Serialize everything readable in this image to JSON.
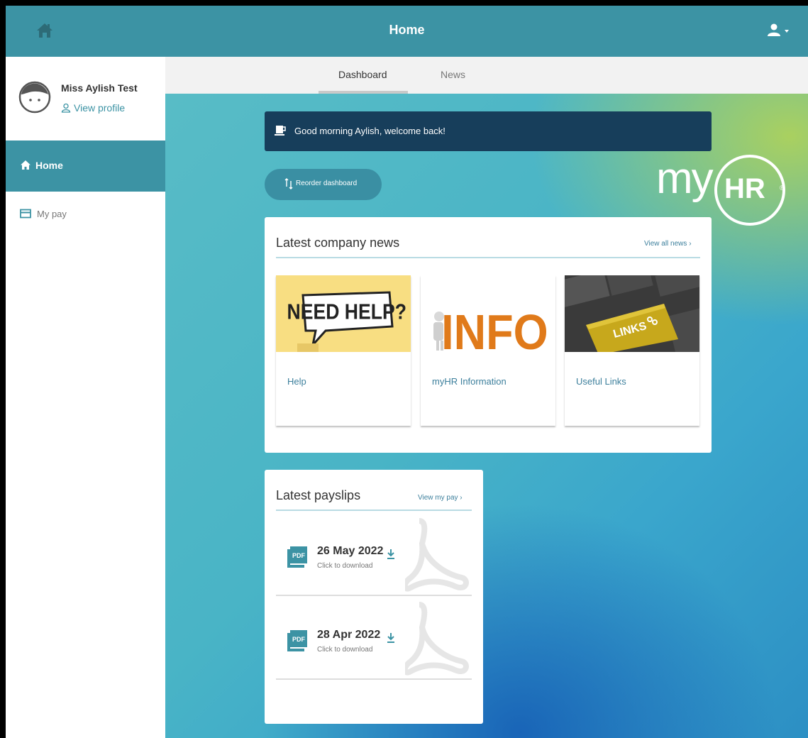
{
  "topbar": {
    "title": "Home",
    "home_icon": "home-icon",
    "user_icon": "user-icon"
  },
  "sidebar": {
    "profile": {
      "name": "Miss Aylish Test",
      "view_profile": "View profile"
    },
    "items": [
      {
        "label": "Home",
        "icon": "home-icon",
        "active": true
      },
      {
        "label": "My pay",
        "icon": "card-icon",
        "active": false
      }
    ]
  },
  "tabs": [
    {
      "label": "Dashboard",
      "active": true
    },
    {
      "label": "News",
      "active": false
    }
  ],
  "main": {
    "greeting": "Good morning Aylish, welcome back!",
    "reorder_label": "Reorder dashboard",
    "logo": {
      "my": "my",
      "hr": "HR",
      "reg": "®"
    },
    "news": {
      "title": "Latest company news",
      "link": "View all news",
      "items": [
        {
          "label": "Help",
          "image_text": "NEED HELP?"
        },
        {
          "label": "myHR Information",
          "image_text": "INFO"
        },
        {
          "label": "Useful Links",
          "image_text": "LINKS"
        }
      ]
    },
    "payslips": {
      "title": "Latest payslips",
      "link": "View my pay",
      "items": [
        {
          "date": "26 May 2022",
          "sub": "Click to download",
          "badge": "PDF"
        },
        {
          "date": "28 Apr 2022",
          "sub": "Click to download",
          "badge": "PDF"
        }
      ]
    }
  },
  "colors": {
    "accent": "#3c93a4",
    "greeting_bg": "#173e5b",
    "link": "#3c7f9c"
  }
}
